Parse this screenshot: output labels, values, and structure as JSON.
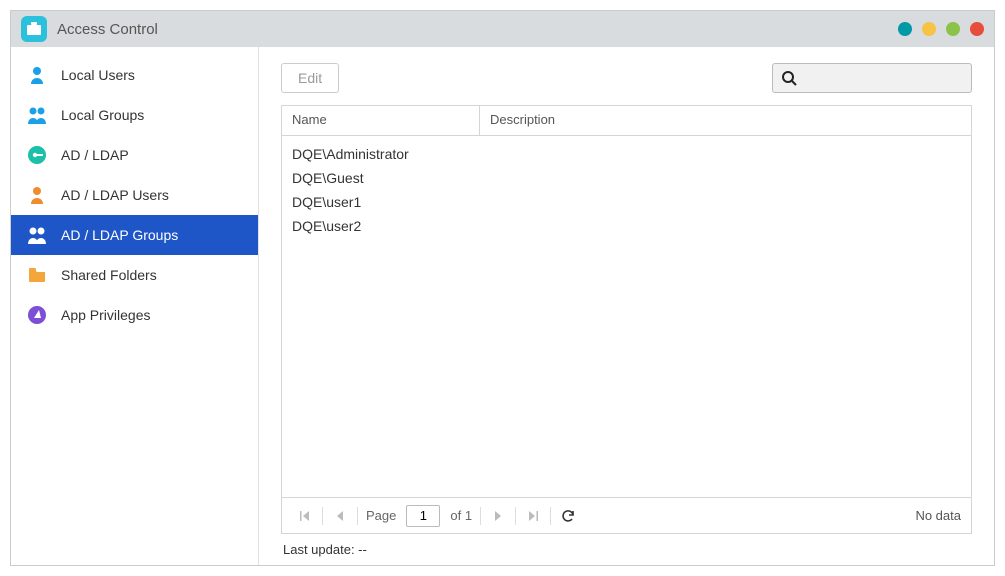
{
  "header": {
    "title": "Access Control"
  },
  "sidebar": {
    "items": [
      {
        "label": "Local Users"
      },
      {
        "label": "Local Groups"
      },
      {
        "label": "AD / LDAP"
      },
      {
        "label": "AD / LDAP Users"
      },
      {
        "label": "AD / LDAP Groups"
      },
      {
        "label": "Shared Folders"
      },
      {
        "label": "App Privileges"
      }
    ],
    "active_index": 4
  },
  "toolbar": {
    "edit_label": "Edit",
    "search_placeholder": ""
  },
  "table": {
    "columns": {
      "name": "Name",
      "description": "Description"
    },
    "rows": [
      {
        "name": "DQE\\Administrator",
        "description": ""
      },
      {
        "name": "DQE\\Guest",
        "description": ""
      },
      {
        "name": "DQE\\user1",
        "description": ""
      },
      {
        "name": "DQE\\user2",
        "description": ""
      }
    ]
  },
  "pager": {
    "page_label": "Page",
    "current_page": "1",
    "of_label": "of 1",
    "no_data": "No data"
  },
  "footer": {
    "last_update_label": "Last update: --"
  },
  "colors": {
    "accent": "#1e56c8"
  }
}
